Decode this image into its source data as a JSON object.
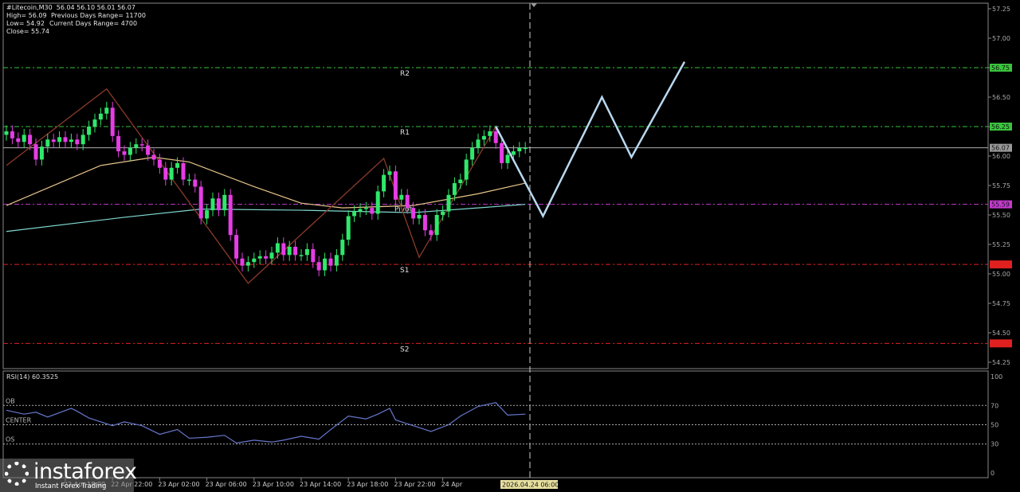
{
  "header": {
    "symbol_line": "#Litecoin,M30  56.04 56.10 56.01 56.07",
    "high": "High= 56.09",
    "low": "Low= 54.92",
    "close": "Close= 55.74",
    "prev_range": "Previous Days Range= 11700",
    "curr_range": "Current Days Range= 4700"
  },
  "logo": {
    "brand": "instaforex",
    "tagline": "Instant Forex Trading"
  },
  "colors": {
    "bull": "#2fe86a",
    "bear": "#e53de5",
    "ma_fast": "#e8c58a",
    "ma_slow": "#7fd8d0",
    "zigzag": "#8b3a2a",
    "forecast": "#b8d8f0",
    "rsi": "#6677cc",
    "resistance": "#39c43c",
    "pivot": "#c53ad0",
    "support": "#e02020",
    "current": "#b0b0b0"
  },
  "chart_data": {
    "type": "candlestick",
    "symbol": "#Litecoin",
    "timeframe": "M30",
    "ylim": [
      54.2,
      57.3
    ],
    "y_ticks": [
      "57.25",
      "57.00",
      "56.75",
      "56.50",
      "56.25",
      "56.00",
      "55.75",
      "55.50",
      "55.25",
      "55.00",
      "54.75",
      "54.50",
      "54.25"
    ],
    "x_ticks": [
      {
        "index": 10,
        "label": "22 Apr 18:00"
      },
      {
        "index": 18,
        "label": "22 Apr 22:00"
      },
      {
        "index": 26,
        "label": "23 Apr 02:00"
      },
      {
        "index": 34,
        "label": "23 Apr 06:00"
      },
      {
        "index": 42,
        "label": "23 Apr 10:00"
      },
      {
        "index": 50,
        "label": "23 Apr 14:00"
      },
      {
        "index": 58,
        "label": "23 Apr 18:00"
      },
      {
        "index": 66,
        "label": "23 Apr 22:00"
      },
      {
        "index": 74,
        "label": "24 Apr"
      }
    ],
    "crosshair_label": "2026.04.24 06:00",
    "closes": [
      56.21,
      56.15,
      56.12,
      56.18,
      56.1,
      55.97,
      56.08,
      56.14,
      56.12,
      56.16,
      56.12,
      56.14,
      56.1,
      56.18,
      56.25,
      56.31,
      56.36,
      56.41,
      56.17,
      56.04,
      56.01,
      56.07,
      56.1,
      56.09,
      56.01,
      55.97,
      55.9,
      55.8,
      55.9,
      55.94,
      55.8,
      55.8,
      55.74,
      55.47,
      55.54,
      55.64,
      55.54,
      55.67,
      55.33,
      55.13,
      55.07,
      55.1,
      55.13,
      55.15,
      55.13,
      55.18,
      55.26,
      55.16,
      55.23,
      55.16,
      55.16,
      55.21,
      55.1,
      55.03,
      55.13,
      55.07,
      55.16,
      55.29,
      55.49,
      55.53,
      55.55,
      55.56,
      55.51,
      55.7,
      55.84,
      55.87,
      55.63,
      55.67,
      55.56,
      55.47,
      55.5,
      55.37,
      55.33,
      55.5,
      55.53,
      55.67,
      55.77,
      55.8,
      55.97,
      56.07,
      56.14,
      56.17,
      56.21,
      56.11,
      55.94,
      56.01,
      56.04,
      56.07,
      56.07
    ],
    "ma_fast": [
      [
        0,
        55.58
      ],
      [
        16,
        55.92
      ],
      [
        25,
        55.99
      ],
      [
        31,
        55.95
      ],
      [
        42,
        55.74
      ],
      [
        50,
        55.6
      ],
      [
        57,
        55.56
      ],
      [
        69,
        55.58
      ],
      [
        80,
        55.68
      ],
      [
        88,
        55.77
      ]
    ],
    "ma_slow": [
      [
        0,
        55.36
      ],
      [
        20,
        55.48
      ],
      [
        33,
        55.55
      ],
      [
        50,
        55.54
      ],
      [
        69,
        55.52
      ],
      [
        80,
        55.56
      ],
      [
        88,
        55.59
      ]
    ],
    "zigzag": [
      [
        0,
        55.92
      ],
      [
        17,
        56.57
      ],
      [
        41,
        54.92
      ],
      [
        64,
        55.98
      ],
      [
        70,
        55.14
      ],
      [
        83,
        56.25
      ]
    ],
    "forecast": [
      [
        83,
        56.25
      ],
      [
        91,
        55.49
      ],
      [
        101,
        56.5
      ],
      [
        106,
        55.99
      ],
      [
        115,
        56.8
      ]
    ],
    "levels": [
      {
        "name": "R2",
        "value": 56.75,
        "label": "56.75",
        "kind": "resistance"
      },
      {
        "name": "R1",
        "value": 56.25,
        "label": "56.25",
        "kind": "resistance"
      },
      {
        "name": "Pivot",
        "value": 55.59,
        "label": "55.59",
        "kind": "pivot"
      },
      {
        "name": "S1",
        "value": 55.08,
        "label": "55.08",
        "kind": "support"
      },
      {
        "name": "S2",
        "value": 54.41,
        "label": "54.41",
        "kind": "support"
      }
    ],
    "level_text": {
      "R2": "R2",
      "R1": "R1",
      "Pivot": "Pivot",
      "S1": "S1",
      "S2": "S2"
    },
    "current_price": {
      "value": 56.07,
      "label": "56.07"
    },
    "rsi": {
      "title": "RSI(14) 60.3525",
      "ylim": [
        0,
        100
      ],
      "y_ticks": [
        "100",
        "70",
        "50",
        "30",
        "0"
      ],
      "levels": [
        {
          "label": "OB",
          "value": 70
        },
        {
          "label": "CENTER",
          "value": 50
        },
        {
          "label": "OS",
          "value": 30
        }
      ],
      "values": [
        [
          0,
          65
        ],
        [
          3,
          61
        ],
        [
          5,
          63
        ],
        [
          7,
          58
        ],
        [
          11,
          67
        ],
        [
          12,
          64
        ],
        [
          14,
          57
        ],
        [
          18,
          49
        ],
        [
          20,
          53
        ],
        [
          23,
          49
        ],
        [
          26,
          40
        ],
        [
          29,
          45
        ],
        [
          31,
          36
        ],
        [
          34,
          37
        ],
        [
          37,
          39
        ],
        [
          39,
          31
        ],
        [
          42,
          34
        ],
        [
          45,
          32
        ],
        [
          47,
          34
        ],
        [
          50,
          38
        ],
        [
          53,
          35
        ],
        [
          55,
          45
        ],
        [
          58,
          59
        ],
        [
          61,
          56
        ],
        [
          63,
          61
        ],
        [
          65,
          67
        ],
        [
          66,
          55
        ],
        [
          69,
          49
        ],
        [
          72,
          43
        ],
        [
          75,
          50
        ],
        [
          77,
          59
        ],
        [
          80,
          69
        ],
        [
          83,
          73
        ],
        [
          85,
          60
        ],
        [
          88,
          61
        ]
      ]
    }
  }
}
